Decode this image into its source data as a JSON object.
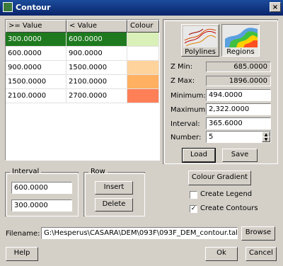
{
  "window": {
    "title": "Contour",
    "close_glyph": "×"
  },
  "table": {
    "columns": [
      ">= Value",
      "< Value",
      "Colour"
    ],
    "rows": [
      {
        "from": "300.0000",
        "to": "600.0000",
        "colour": "#d9f0b8",
        "selected": true
      },
      {
        "from": "600.0000",
        "to": "900.0000",
        "colour": "#ffffff"
      },
      {
        "from": "900.0000",
        "to": "1500.0000",
        "colour": "#ffd39c"
      },
      {
        "from": "1500.0000",
        "to": "2100.0000",
        "colour": "#ffb061"
      },
      {
        "from": "2100.0000",
        "to": "2700.0000",
        "colour": "#ff7f57"
      }
    ]
  },
  "style_panel": {
    "polylines_label": "Polylines",
    "regions_label": "Regions"
  },
  "stats": {
    "zmin_label": "Z Min:",
    "zmin_value": "685.0000",
    "zmax_label": "Z Max:",
    "zmax_value": "1896.0000",
    "minimum_label": "Minimum:",
    "minimum_value": "494.0000",
    "maximum_label": "Maximum:",
    "maximum_value": "2,322.0000",
    "interval_label": "Interval:",
    "interval_value": "365.6000",
    "number_label": "Number:",
    "number_value": "5"
  },
  "buttons": {
    "load": "Load",
    "save": "Save",
    "colour_gradient": "Colour Gradient",
    "insert": "Insert",
    "delete": "Delete",
    "browse": "Browse",
    "help": "Help",
    "ok": "Ok",
    "cancel": "Cancel"
  },
  "interval_group": {
    "label": "Interval",
    "value1": "600.0000",
    "value2": "300.0000"
  },
  "row_group": {
    "label": "Row"
  },
  "options": {
    "create_legend": {
      "label": "Create Legend",
      "checked": false
    },
    "create_contours": {
      "label": "Create Contours",
      "checked": true
    }
  },
  "filename": {
    "label": "Filename:",
    "value": "G:\\Hesperus\\CASARA\\DEM\\093F\\093F_DEM_contour.tab"
  },
  "icons": {
    "check": "✓",
    "spin_up": "▲",
    "spin_down": "▼"
  }
}
